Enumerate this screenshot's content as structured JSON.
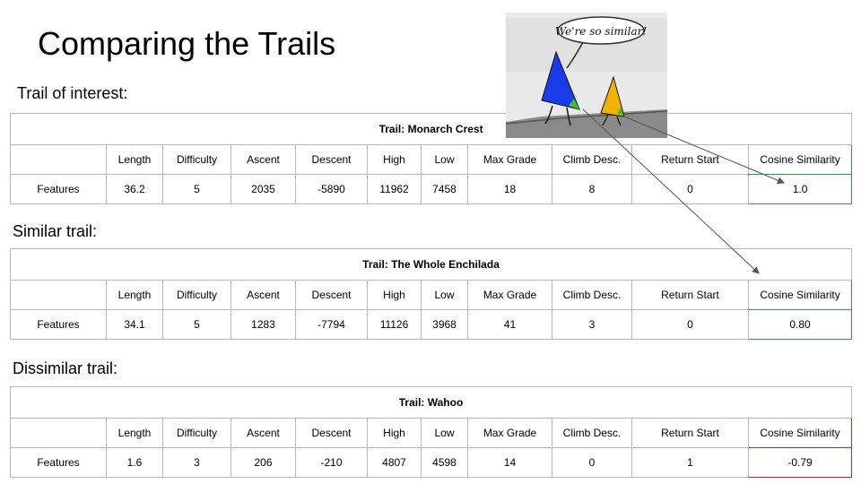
{
  "slide": {
    "title": "Comparing the Trails"
  },
  "colors": {
    "similar_border": "#2ea043",
    "dissimilar_border": "#c62828",
    "triangle_blue": "#1a3be8",
    "triangle_orange": "#f0b400",
    "corner_green": "#3dbf2f"
  },
  "cartoon": {
    "speech": "We're so similar!",
    "icon": "two-triangle-characters"
  },
  "columns": [
    "",
    "Length",
    "Difficulty",
    "Ascent",
    "Descent",
    "High",
    "Low",
    "Max Grade",
    "Climb Desc.",
    "Return Start",
    "Cosine Similarity"
  ],
  "sections": [
    {
      "label": "Trail of interest:",
      "trail": "Trail: Monarch Crest",
      "row": {
        "label": "Features",
        "values": [
          "36.2",
          "5",
          "2035",
          "-5890",
          "11962",
          "7458",
          "18",
          "8",
          "0",
          "1.0"
        ]
      }
    },
    {
      "label": "Similar trail:",
      "trail": "Trail: The Whole Enchilada",
      "row": {
        "label": "Features",
        "values": [
          "34.1",
          "5",
          "1283",
          "-7794",
          "11126",
          "3968",
          "41",
          "3",
          "0",
          "0.80"
        ]
      }
    },
    {
      "label": "Dissimilar trail:",
      "trail": "Trail: Wahoo",
      "row": {
        "label": "Features",
        "values": [
          "1.6",
          "3",
          "206",
          "-210",
          "4807",
          "4598",
          "14",
          "0",
          "1",
          "-0.79"
        ]
      }
    }
  ]
}
